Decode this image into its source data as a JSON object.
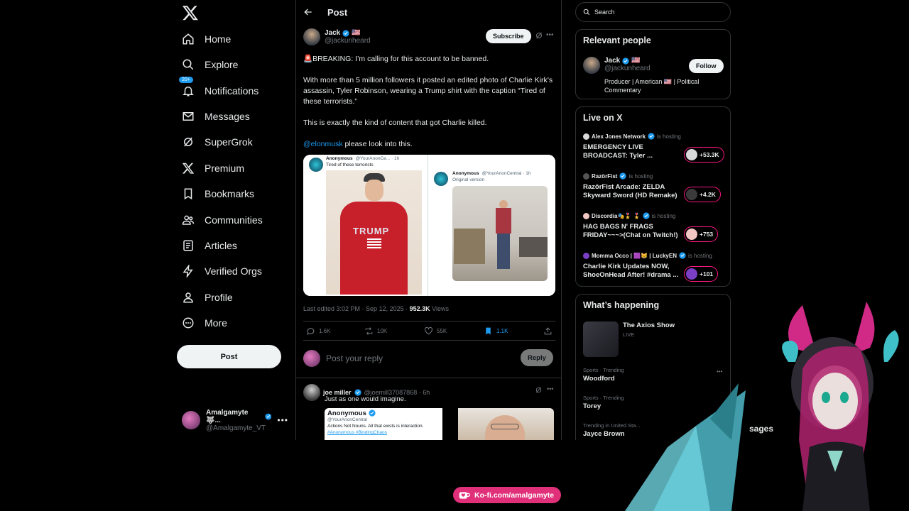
{
  "nav": {
    "items": [
      {
        "label": "Home",
        "icon": "home-icon"
      },
      {
        "label": "Explore",
        "icon": "search-icon"
      },
      {
        "label": "Notifications",
        "icon": "bell-icon",
        "badge": "20+"
      },
      {
        "label": "Messages",
        "icon": "mail-icon"
      },
      {
        "label": "SuperGrok",
        "icon": "grok-icon"
      },
      {
        "label": "Premium",
        "icon": "x-logo-icon"
      },
      {
        "label": "Bookmarks",
        "icon": "bookmark-icon"
      },
      {
        "label": "Communities",
        "icon": "people-icon"
      },
      {
        "label": "Articles",
        "icon": "article-icon"
      },
      {
        "label": "Verified Orgs",
        "icon": "bolt-icon"
      },
      {
        "label": "Profile",
        "icon": "person-icon"
      },
      {
        "label": "More",
        "icon": "more-circle-icon"
      }
    ],
    "post_label": "Post",
    "account": {
      "name": "Amalgamyte 🐺...",
      "handle": "@Amalgamyte_VT"
    }
  },
  "header": {
    "title": "Post"
  },
  "post": {
    "author_name": "Jack",
    "author_flag": "🇺🇸",
    "author_handle": "@jackunheard",
    "subscribe_label": "Subscribe",
    "p1": "🚨BREAKING: I’m calling for this account to be banned.",
    "p2": "With more than 5 million followers it posted an edited photo of Charlie Kirk’s assassin, Tyler Robinson, wearing a Trump shirt with the caption “Tired of these terrorists.”",
    "p3": "This is exactly the kind of content that got Charlie killed.",
    "mention": "@elonmusk",
    "p4_rest": " please look into this.",
    "media_left": {
      "name": "Anonymous",
      "handle": "@YourAnonCe... · 1h",
      "caption": "Tired of these terrorists",
      "shirt_text": "TRUMP"
    },
    "media_right": {
      "name": "Anonymous",
      "handle": "@YourAnonCentral · 1h",
      "caption": "Original version"
    },
    "edited": "Last edited 3:02 PM · Sep 12, 2025 · ",
    "views_count": "952.3K",
    "views_label": " Views",
    "replies": "1.6K",
    "reposts": "10K",
    "likes": "55K",
    "bookmarks": "1.1K"
  },
  "reply": {
    "placeholder": "Post your reply",
    "button": "Reply"
  },
  "comment": {
    "name": "joe miller",
    "handle": "@joemill37087868 · 6h",
    "text": "Just as one would imagine.",
    "quote_name": "Anonymous",
    "quote_handle": "@YourAnonCentral",
    "quote_text": "Actions Not Nouns. All that exists is interaction. ",
    "quote_tags": "#Anonymous #BindingChaos"
  },
  "sidebar": {
    "search_placeholder": "Search",
    "relevant_title": "Relevant people",
    "relevant": {
      "name": "Jack",
      "flag": "🇺🇸",
      "handle": "@jackunheard",
      "bio": "Producer | American 🇺🇸 | Political Commentary",
      "follow_label": "Follow"
    },
    "live_title": "Live on X",
    "live": [
      {
        "host": "Alex Jones Network",
        "status": "is hosting",
        "title": "EMERGENCY LIVE BROADCAST: Tyler ...",
        "count": "+53.3K",
        "color": "#d9d9d9"
      },
      {
        "host": "RazörFist",
        "status": "is hosting",
        "title": "RazörFist Arcade: ZELDA Skyward Sword (HD Remake)",
        "count": "+4.2K",
        "color": "#3a3a3a"
      },
      {
        "host": "Discordia🎭🎖️ 🎖️",
        "status": "is hosting",
        "title": "HAG BAGS N' FRAGS FRIDAY~~~>(Chat on Twitch!)",
        "count": "+753",
        "color": "#f2c6c2"
      },
      {
        "host": "Momma Occo | 🟪😸 | LuckyEN",
        "status": "is hosting",
        "title": "Charlie Kirk Updates NOW, ShoeOnHead After! #drama ...",
        "count": "+101",
        "color": "#7b3fc6"
      }
    ],
    "happening_title": "What’s happening",
    "happening": {
      "name": "The Axios Show",
      "status": "LIVE"
    },
    "trends": [
      {
        "category": "Sports · Trending",
        "name": "Woodford"
      },
      {
        "category": "Sports · Trending",
        "name": "Torey"
      },
      {
        "category": "Trending in United Sta...",
        "name": "Jayce Brown"
      }
    ],
    "messages_partial": "sages"
  },
  "overlay": {
    "kofi": "Ko-fi.com/amalgamyte"
  }
}
